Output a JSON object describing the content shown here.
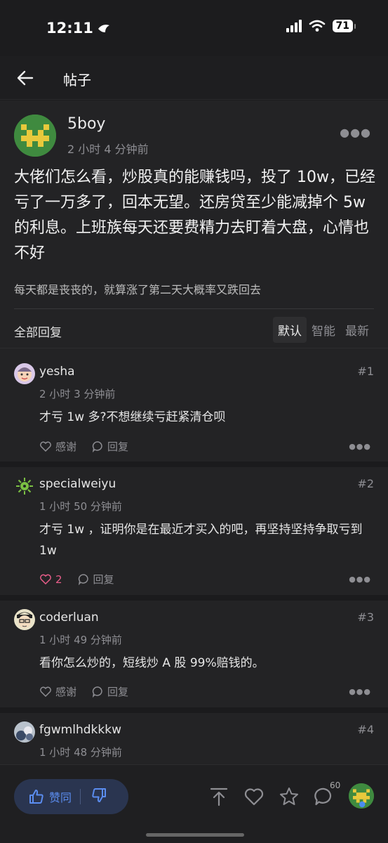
{
  "status_bar": {
    "time": "12:11",
    "battery": "71"
  },
  "nav": {
    "title": "帖子"
  },
  "post": {
    "author": "5boy",
    "time": "2 小时 4 分钟前",
    "title": "大佬们怎么看，炒股真的能赚钱吗，投了 10w，已经亏了一万多了，回本无望。还房贷至少能减掉个 5w 的利息。上班族每天还要费精力去盯着大盘，心情也不好",
    "subtitle": "每天都是丧丧的，就算涨了第二天大概率又跌回去"
  },
  "replies_header": {
    "label": "全部回复",
    "sort_options": [
      "默认",
      "智能",
      "最新"
    ],
    "active_sort": "默认"
  },
  "replies": [
    {
      "user": "yesha",
      "num": "#1",
      "time": "2 小时 3 分钟前",
      "body": "才亏 1w 多?不想继续亏赶紧清仓呗",
      "thanks": "感谢",
      "reply": "回复",
      "avatar_icon": "smiling-cartoon-face-icon"
    },
    {
      "user": "specialweiyu",
      "num": "#2",
      "time": "1 小时 50 分钟前",
      "body": "才亏 1w ，证明你是在最近才买入的吧，再坚持坚持争取亏到 1w",
      "thanks": "2",
      "reply": "回复",
      "avatar_icon": "green-virus-icon"
    },
    {
      "user": "coderluan",
      "num": "#3",
      "time": "1 小时 49 分钟前",
      "body": "看你怎么炒的，短线炒 A 股 99%赔钱的。",
      "thanks": "感谢",
      "reply": "回复",
      "avatar_icon": "cartoon-face-glasses-icon"
    },
    {
      "user": "fgwmlhdkkkw",
      "num": "#4",
      "time": "1 小时 48 分钟前",
      "avatar_icon": "photo-avatar-icon"
    }
  ],
  "bottom_bar": {
    "agree_label": "赞同",
    "comment_count": "60"
  },
  "colors": {
    "accent": "#5b8df0",
    "liked": "#e85d8a",
    "background": "#232325"
  }
}
